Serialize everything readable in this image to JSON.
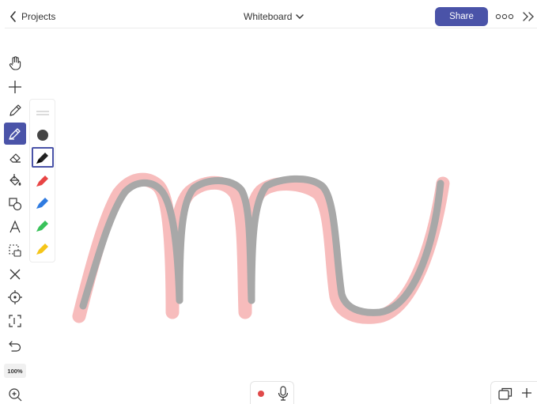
{
  "header": {
    "back_label": "Projects",
    "board_title": "Whiteboard",
    "share_label": "Share",
    "icons": [
      "chevron-left-icon",
      "chevron-down-icon",
      "more-icon",
      "double-chevron-right-icon"
    ]
  },
  "toolbar": {
    "tools": [
      "hand",
      "add",
      "pen",
      "highlighter",
      "eraser",
      "fill",
      "shapes",
      "text",
      "select",
      "close",
      "target",
      "scan",
      "undo",
      "zoom-in"
    ],
    "active_tool": "highlighter",
    "zoom_label": "100%"
  },
  "palette": {
    "items": [
      "line-width",
      "fill-dot",
      "pen-black",
      "pen-red",
      "pen-blue",
      "pen-green",
      "pen-yellow"
    ],
    "selected": "pen-black",
    "colors": {
      "black": "#222222",
      "red": "#e84545",
      "blue": "#2f7be0",
      "green": "#39c25a",
      "yellow": "#f5c518"
    }
  },
  "canvas": {
    "stroke_colors": {
      "highlight": "#f7bcbc",
      "ink": "#a8a8a8"
    }
  },
  "bottom": {
    "record_color": "#e04a4a",
    "icons": [
      "record-icon",
      "microphone-icon",
      "pages-icon",
      "add-icon"
    ]
  },
  "accent_color": "#4a53a8"
}
